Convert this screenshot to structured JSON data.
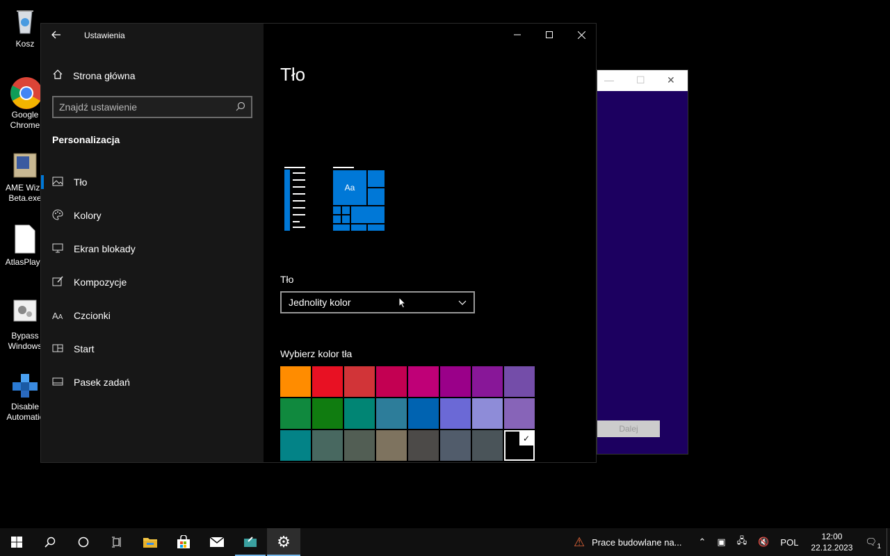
{
  "desktop": {
    "icons": [
      {
        "label": "Kosz",
        "icon": "recycle-bin-icon"
      },
      {
        "label": "Google\nChrome",
        "icon": "chrome-icon"
      },
      {
        "label": "AME Wiza\nBeta.exe",
        "icon": "ame-wizard-icon"
      },
      {
        "label": "AtlasPlayb",
        "icon": "file-icon"
      },
      {
        "label": "Bypass\nWindows",
        "icon": "settings-file-icon"
      },
      {
        "label": "Disable\nAutomatic",
        "icon": "blocks-icon"
      }
    ]
  },
  "background_window": {
    "next_label": "Dalej",
    "bg_color": "#1c0060"
  },
  "settings": {
    "app_title": "Ustawienia",
    "home_label": "Strona główna",
    "search_placeholder": "Znajdź ustawienie",
    "section_title": "Personalizacja",
    "nav": [
      {
        "label": "Tło",
        "icon": "image-icon",
        "active": true
      },
      {
        "label": "Kolory",
        "icon": "palette-icon"
      },
      {
        "label": "Ekran blokady",
        "icon": "monitor-icon"
      },
      {
        "label": "Kompozycje",
        "icon": "brush-icon"
      },
      {
        "label": "Czcionki",
        "icon": "font-icon"
      },
      {
        "label": "Start",
        "icon": "start-icon"
      },
      {
        "label": "Pasek zadań",
        "icon": "taskbar-icon"
      }
    ],
    "page_title": "Tło",
    "preview_tile_text": "Aa",
    "background_label": "Tło",
    "background_value": "Jednolity kolor",
    "colors_label": "Wybierz kolor tła",
    "colors": [
      "#ff8c00",
      "#e81123",
      "#d13438",
      "#c30052",
      "#bf0077",
      "#9a0089",
      "#881798",
      "#744da9",
      "#10893e",
      "#107c10",
      "#018574",
      "#2d7d9a",
      "#0063b1",
      "#6b69d6",
      "#8e8cd8",
      "#8764b8",
      "#038387",
      "#486860",
      "#525e54",
      "#7e735f",
      "#4c4a48",
      "#515c6b",
      "#4a5459",
      "#000000"
    ],
    "selected_color_index": 23,
    "accent": "#0078d7"
  },
  "taskbar": {
    "news_text": "Prace budowlane na...",
    "language": "POL",
    "time": "12:00",
    "date": "22.12.2023",
    "notification_count": "1"
  }
}
